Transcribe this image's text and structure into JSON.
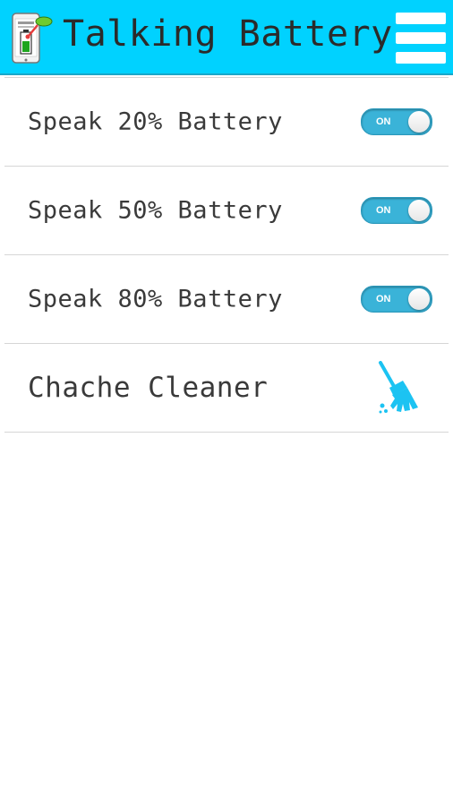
{
  "header": {
    "title": "Talking Battery",
    "app_icon": "battery-phone-icon",
    "menu_icon": "hamburger-menu-icon"
  },
  "colors": {
    "header_bg": "#00d2ff",
    "toggle_on": "#3ab3d8",
    "broom": "#1cc3f2"
  },
  "settings": {
    "items": [
      {
        "label": "Speak 20% Battery",
        "toggle_label": "ON",
        "state": "on"
      },
      {
        "label": "Speak 50% Battery",
        "toggle_label": "ON",
        "state": "on"
      },
      {
        "label": "Speak 80% Battery",
        "toggle_label": "ON",
        "state": "on"
      }
    ],
    "cleaner": {
      "label": "Chache Cleaner",
      "icon": "broom-icon"
    }
  }
}
